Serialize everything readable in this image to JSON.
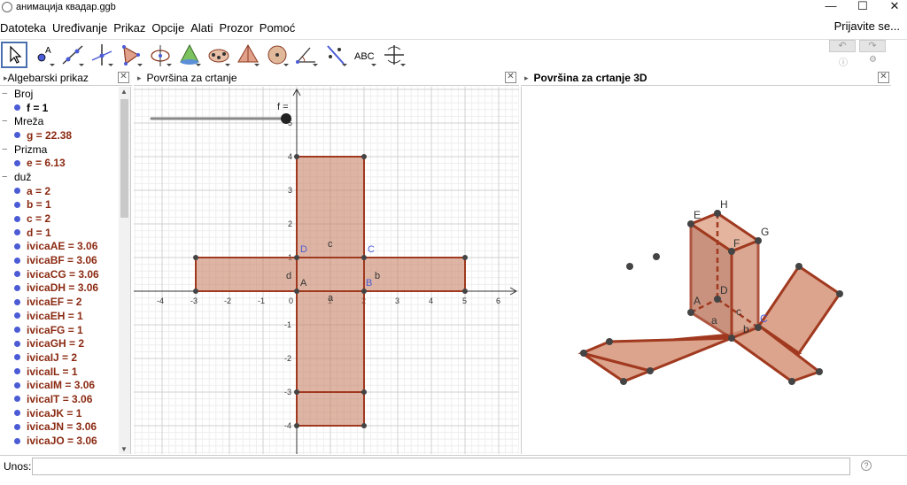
{
  "window": {
    "title": "анимација квадар.ggb",
    "minimize": "—",
    "maximize": "☐",
    "close": "✕"
  },
  "menu": {
    "items": [
      "Datoteka",
      "Uređivanje",
      "Prikaz",
      "Opcije",
      "Alati",
      "Prozor",
      "Pomoć"
    ],
    "signin": "Prijavite se..."
  },
  "toolbar": {
    "tools": [
      "move",
      "point",
      "line",
      "perpendicular",
      "polygon",
      "circle",
      "conic",
      "slider-points",
      "pyramid",
      "sphere",
      "angle",
      "reflect",
      "text",
      "rotate-view"
    ],
    "text_tool_label": "ABC",
    "undo": "↶",
    "redo": "↷"
  },
  "algebra": {
    "header": "Algebarski prikaz",
    "groups": [
      {
        "name": "Broj",
        "items": [
          {
            "text": "f = 1",
            "color": "black"
          }
        ]
      },
      {
        "name": "Mreža",
        "items": [
          {
            "text": "g = 22.38"
          }
        ]
      },
      {
        "name": "Prizma",
        "items": [
          {
            "text": "e = 6.13"
          }
        ]
      },
      {
        "name": "duž",
        "items": [
          {
            "text": "a = 2"
          },
          {
            "text": "b = 1"
          },
          {
            "text": "c = 2"
          },
          {
            "text": "d = 1"
          },
          {
            "text": "ivicaAE = 3.06"
          },
          {
            "text": "ivicaBF = 3.06"
          },
          {
            "text": "ivicaCG = 3.06"
          },
          {
            "text": "ivicaDH = 3.06"
          },
          {
            "text": "ivicaEF = 2"
          },
          {
            "text": "ivicaEH = 1"
          },
          {
            "text": "ivicaFG = 1"
          },
          {
            "text": "ivicaGH = 2"
          },
          {
            "text": "ivicaIJ = 2"
          },
          {
            "text": "ivicaIL = 1"
          },
          {
            "text": "ivicaIM = 3.06"
          },
          {
            "text": "ivicaIT = 3.06"
          },
          {
            "text": "ivicaJK = 1"
          },
          {
            "text": "ivicaJN = 3.06"
          },
          {
            "text": "ivicaJO = 3.06"
          }
        ]
      }
    ]
  },
  "graphics2d": {
    "header": "Površina za crtanje",
    "slider_label": "f =",
    "x_ticks": [
      "-4",
      "-3",
      "-2",
      "-1",
      "0",
      "1",
      "2",
      "3",
      "4",
      "5",
      "6"
    ],
    "y_ticks": [
      "5",
      "4",
      "3",
      "2",
      "1",
      "-1",
      "-2",
      "-3",
      "-4"
    ],
    "labels": {
      "A": "A",
      "B": "B",
      "C": "C",
      "D": "D",
      "a": "a",
      "b": "b",
      "c": "c",
      "d": "d"
    }
  },
  "graphics3d": {
    "header": "Površina za crtanje 3D",
    "labels": {
      "E": "E",
      "H": "H",
      "F": "F",
      "G": "G",
      "D": "D",
      "A": "A",
      "C": "C",
      "a": "a",
      "c": "c",
      "b": "b"
    }
  },
  "input": {
    "label": "Unos:",
    "value": "",
    "help": "?"
  },
  "colors": {
    "face_fill": "#d7a088",
    "edge": "#a0391f",
    "point_blue": "#4b5bd6"
  }
}
